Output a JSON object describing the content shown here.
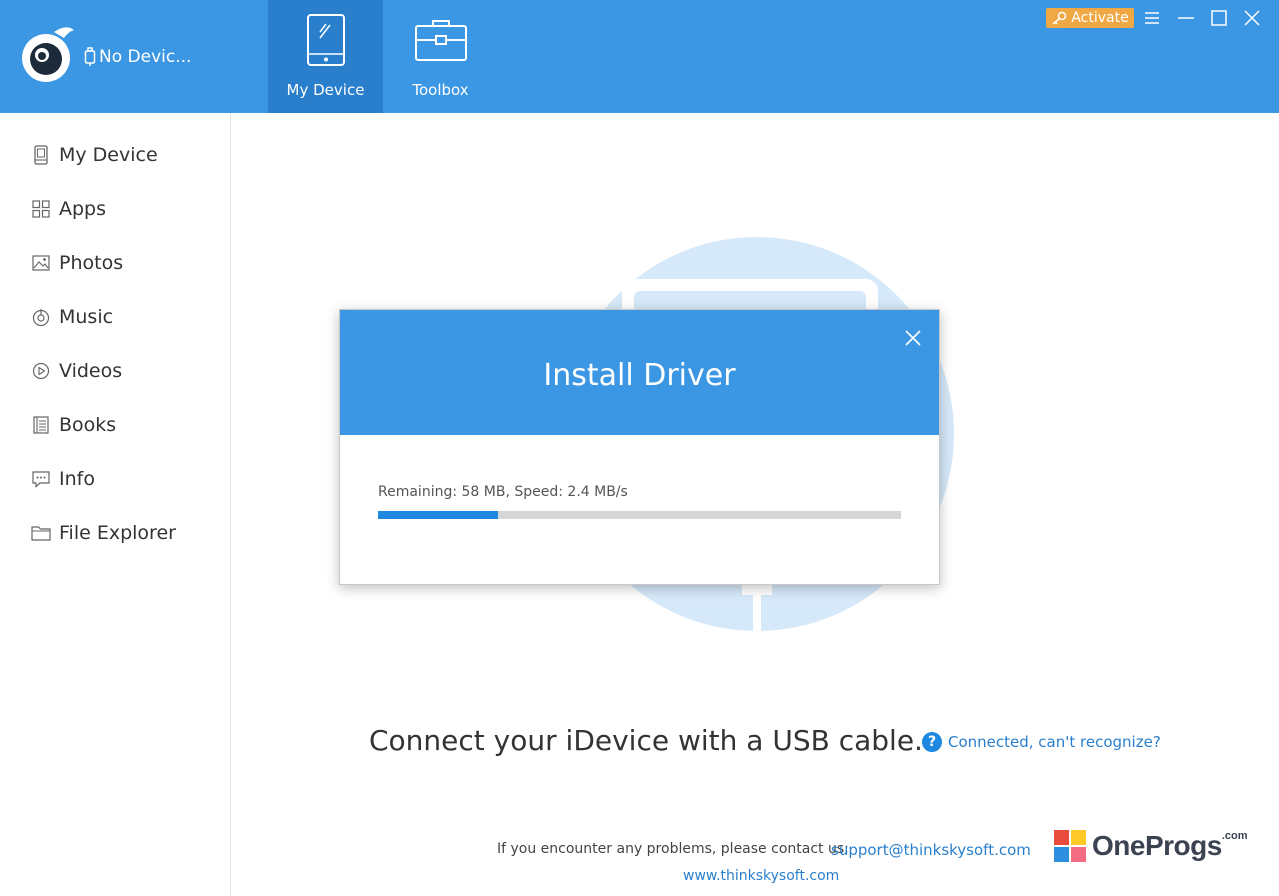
{
  "app": {
    "device_status": "No Devic...",
    "activate_label": "Activate"
  },
  "nav_tabs": [
    {
      "label": "My Device",
      "icon": "tablet-icon",
      "active": true
    },
    {
      "label": "Toolbox",
      "icon": "toolbox-icon",
      "active": false
    }
  ],
  "window_controls": [
    "menu-icon",
    "minimize-icon",
    "maximize-icon",
    "close-icon"
  ],
  "sidebar": {
    "items": [
      {
        "label": "My Device",
        "icon": "device-icon"
      },
      {
        "label": "Apps",
        "icon": "apps-grid-icon"
      },
      {
        "label": "Photos",
        "icon": "photo-icon"
      },
      {
        "label": "Music",
        "icon": "music-icon"
      },
      {
        "label": "Videos",
        "icon": "video-play-icon"
      },
      {
        "label": "Books",
        "icon": "book-icon"
      },
      {
        "label": "Info",
        "icon": "message-icon"
      },
      {
        "label": "File Explorer",
        "icon": "folder-icon"
      }
    ]
  },
  "main": {
    "connect_message": "Connect your iDevice with a USB cable.",
    "help_link": "Connected, can't recognize?",
    "contact_text": "If you encounter any problems, please contact us:",
    "contact_email": "support@thinkskysoft.com",
    "website": "www.thinkskysoft.com"
  },
  "watermark": {
    "text": "OneProgs",
    "suffix": ".com"
  },
  "dialog": {
    "title": "Install Driver",
    "progress_text": "Remaining: 58 MB, Speed: 2.4 MB/s",
    "progress_fraction": 0.23
  },
  "colors": {
    "primary": "#3b97e3",
    "active_tab": "#2a7fcd",
    "activate": "#f0a845",
    "progress": "#1f88e0",
    "link": "#2a7fcd"
  }
}
